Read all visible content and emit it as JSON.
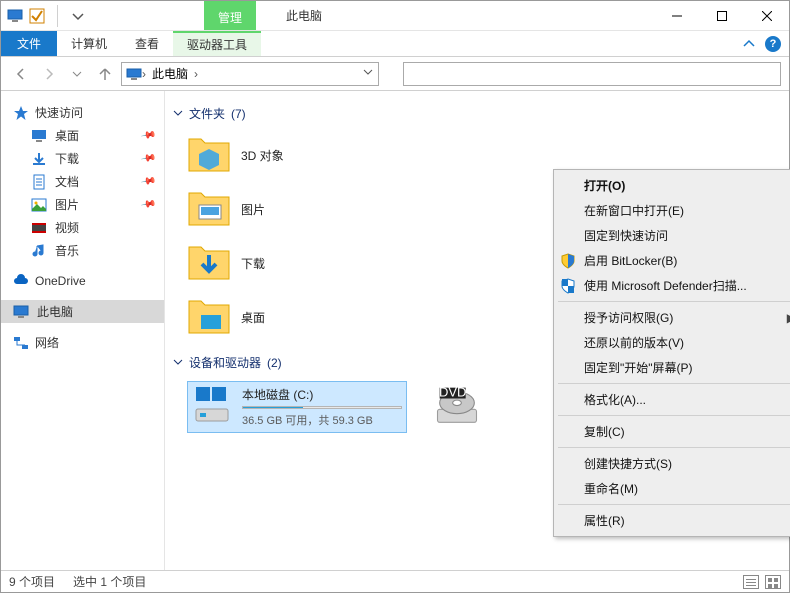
{
  "title": "此电脑",
  "contextual_tab": "管理",
  "menubar": {
    "file": "文件",
    "computer": "计算机",
    "view": "查看",
    "drive_tools": "驱动器工具"
  },
  "addressbar": {
    "location": "此电脑"
  },
  "sidebar": {
    "quick_access": "快速访问",
    "desktop": "桌面",
    "downloads": "下载",
    "documents": "文档",
    "pictures": "图片",
    "videos": "视频",
    "music": "音乐",
    "onedrive": "OneDrive",
    "this_pc": "此电脑",
    "network": "网络"
  },
  "sections": {
    "folders_label": "文件夹",
    "folders_count": "(7)",
    "drives_label": "设备和驱动器",
    "drives_count": "(2)"
  },
  "folders": {
    "objects3d": "3D 对象",
    "pictures": "图片",
    "downloads": "下载",
    "desktop": "桌面"
  },
  "drive_c": {
    "name": "本地磁盘 (C:)",
    "subtitle": "36.5 GB 可用，共 59.3 GB",
    "free_gb": 36.5,
    "total_gb": 59.3,
    "fill_percent": 38
  },
  "context_menu": {
    "open": "打开(O)",
    "open_new_window": "在新窗口中打开(E)",
    "pin_quick_access": "固定到快速访问",
    "bitlocker": "启用 BitLocker(B)",
    "defender": "使用 Microsoft Defender扫描...",
    "grant_access": "授予访问权限(G)",
    "restore_versions": "还原以前的版本(V)",
    "pin_start": "固定到\"开始\"屏幕(P)",
    "format": "格式化(A)...",
    "copy": "复制(C)",
    "create_shortcut": "创建快捷方式(S)",
    "rename": "重命名(M)",
    "properties": "属性(R)"
  },
  "statusbar": {
    "items": "9 个项目",
    "selected": "选中 1 个项目"
  }
}
